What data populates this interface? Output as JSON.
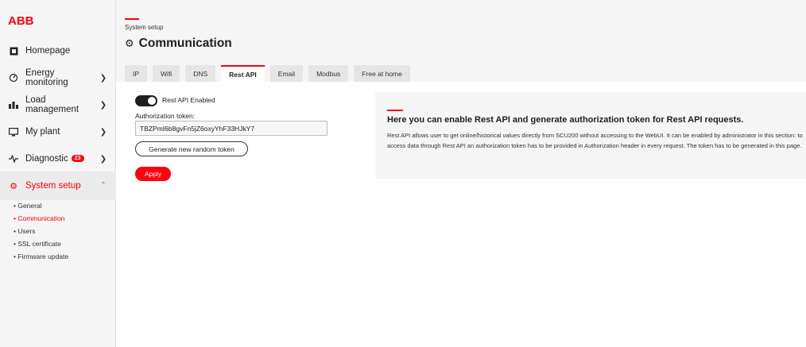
{
  "brand": {
    "logo_text": "ABB",
    "accent_color": "#ff000f"
  },
  "sidebar": {
    "items": [
      {
        "label": "Homepage",
        "icon": "home-icon"
      },
      {
        "label": "Energy monitoring",
        "icon": "energy-icon"
      },
      {
        "label": "Load management",
        "icon": "load-icon"
      },
      {
        "label": "My plant",
        "icon": "plant-icon"
      },
      {
        "label": "Diagnostic",
        "icon": "diagnostic-icon",
        "badge": "23"
      },
      {
        "label": "System setup",
        "icon": "gear-icon",
        "active": true
      }
    ],
    "subitems": [
      {
        "label": "General"
      },
      {
        "label": "Communication",
        "active": true
      },
      {
        "label": "Users"
      },
      {
        "label": "SSL certificate"
      },
      {
        "label": "Firmware update"
      }
    ]
  },
  "header": {
    "breadcrumb": "System setup",
    "title": "Communication"
  },
  "tabs": [
    {
      "label": "IP"
    },
    {
      "label": "Wifi"
    },
    {
      "label": "DNS"
    },
    {
      "label": "Rest API",
      "active": true
    },
    {
      "label": "Email"
    },
    {
      "label": "Modbus"
    },
    {
      "label": "Free at home"
    }
  ],
  "form": {
    "toggle_label": "Rest API Enabled",
    "toggle_on": true,
    "token_label": "Authorization token:",
    "token_value": "TBZPmI6b8gvFn5jZ6oxyYhF33HJkY7",
    "generate_label": "Generate new random token",
    "apply_label": "Apply"
  },
  "info": {
    "title": "Here you can enable Rest API and generate authorization token for Rest API requests.",
    "text": "Rest API allows user to get online/historical values directly from SCU200 without accessing to the WebUI. It can be enabled by administrator in this section: to access data through Rest API an authorization token has to be provided in Authorization header in every request. The token has to be generated in this page."
  }
}
